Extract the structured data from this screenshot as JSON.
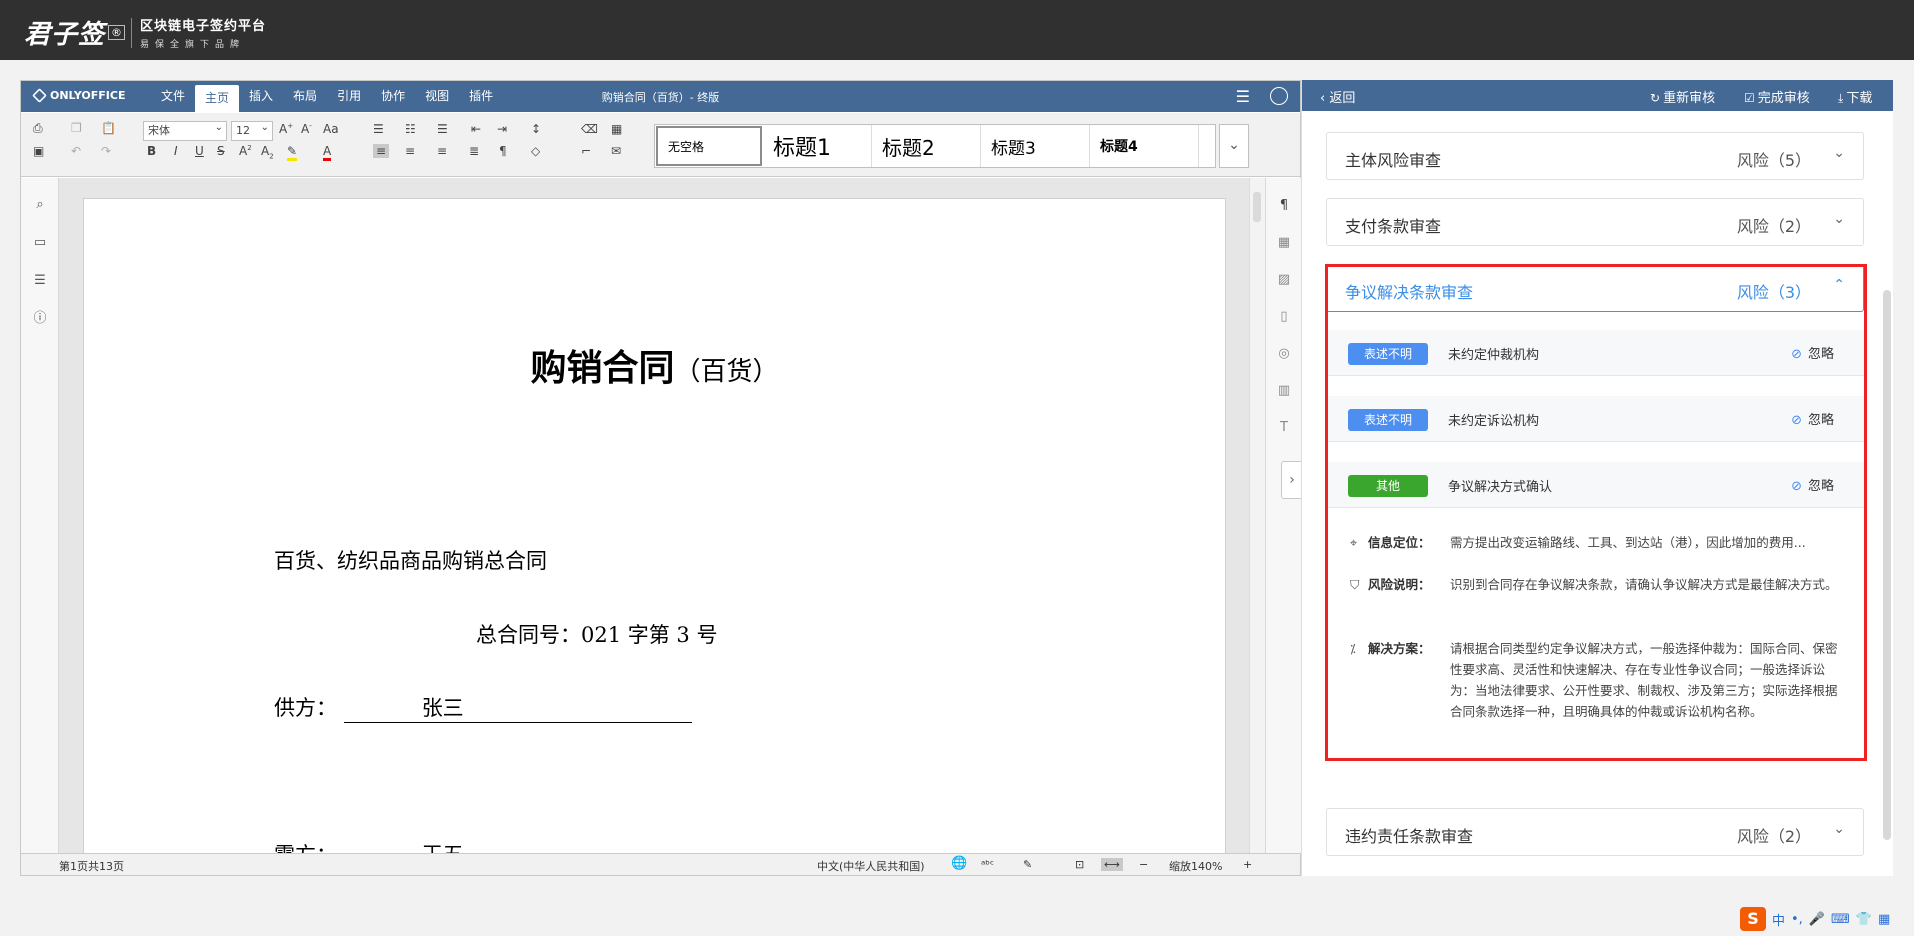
{
  "header": {
    "logo_main": "君子签",
    "logo_mark": "®",
    "logo_line1": "区块链电子签约平台",
    "logo_line2": "易保全旗下品牌"
  },
  "editor": {
    "brand": "ONLYOFFICE",
    "tabs": [
      "文件",
      "主页",
      "插入",
      "布局",
      "引用",
      "协作",
      "视图",
      "插件"
    ],
    "active_tab": "主页",
    "doc_title": "购销合同（百货）- 终版",
    "font_name": "宋体",
    "font_size": "12",
    "styles": [
      "无空格",
      "标题1",
      "标题2",
      "标题3",
      "标题4"
    ],
    "document": {
      "title_main": "购销合同",
      "title_sub": "（百货）",
      "line1": "百货、纺织品商品购销总合同",
      "line2": "总合同号：021  字第 3  号",
      "supplier_label": "供方：",
      "supplier_value": "张三",
      "buyer_label": "需方：",
      "buyer_value": "王五"
    },
    "status": {
      "page_info": "第1页共13页",
      "language": "中文(中华人民共和国)",
      "zoom": "缩放140%"
    }
  },
  "panel": {
    "back": "返回",
    "recheck": "重新审核",
    "complete": "完成审核",
    "download": "下载",
    "sections": [
      {
        "name": "主体风险审查",
        "risk": "风险（5）"
      },
      {
        "name": "支付条款审查",
        "risk": "风险（2）"
      },
      {
        "name": "争议解决条款审查",
        "risk": "风险（3）"
      },
      {
        "name": "违约责任条款审查",
        "risk": "风险（2）"
      }
    ],
    "items": [
      {
        "badge": "表述不明",
        "text": "未约定仲裁机构",
        "action": "忽略",
        "color": "#4d8ff0"
      },
      {
        "badge": "表述不明",
        "text": "未约定诉讼机构",
        "action": "忽略",
        "color": "#4d8ff0"
      },
      {
        "badge": "其他",
        "text": "争议解决方式确认",
        "action": "忽略",
        "color": "#3aa62e"
      }
    ],
    "detail": {
      "location_label": "信息定位：",
      "location_text": "需方提出改变运输路线、工具、到达站（港），因此增加的费用...",
      "risk_label": "风险说明：",
      "risk_text": "识别到合同存在争议解决条款，请确认争议解决方式是最佳解决方式。",
      "solution_label": "解决方案：",
      "solution_text": "请根据合同类型约定争议解决方式，一般选择仲裁为：国际合同、保密性要求高、灵活性和快速解决、存在专业性争议合同；一般选择诉讼为：当地法律要求、公开性要求、制裁权、涉及第三方；实际选择根据合同条款选择一种，且明确具体的仲裁或诉讼机构名称。"
    }
  },
  "ime": {
    "logo": "S",
    "lang": "中"
  },
  "colors": {
    "editor_header": "#446995",
    "active_section": "#3a8ee6",
    "highlight_frame": "#e22"
  }
}
